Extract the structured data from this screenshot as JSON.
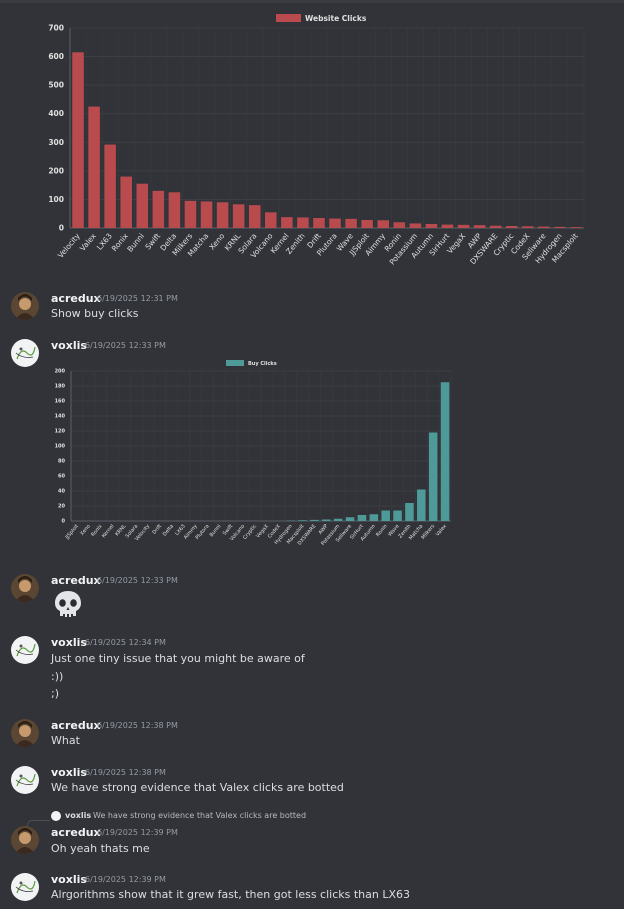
{
  "chart_data": [
    {
      "type": "bar",
      "legend": "Website Clicks",
      "color": "#b94a4d",
      "ylim": [
        0,
        700
      ],
      "yticks": [
        0,
        100,
        200,
        300,
        400,
        500,
        600,
        700
      ],
      "categories": [
        "Velocity",
        "Valex",
        "LX63",
        "Ronix",
        "Bunni",
        "Swift",
        "Delta",
        "Milkers",
        "Matcha",
        "Xeno",
        "KRNL",
        "Solara",
        "Volcano",
        "Kernel",
        "Zenith",
        "Drift",
        "Plutora",
        "Wave",
        "JJSploit",
        "Aimmy",
        "Ronin",
        "Potassium",
        "Autumn",
        "SirHurt",
        "VegaX",
        "AWP",
        "DXSWARE",
        "Cryptic",
        "CodeX",
        "Seliware",
        "Hydrogen",
        "Macsploit"
      ],
      "values": [
        615,
        425,
        292,
        180,
        155,
        130,
        125,
        95,
        93,
        90,
        83,
        80,
        55,
        38,
        37,
        35,
        33,
        32,
        28,
        27,
        20,
        16,
        14,
        12,
        11,
        10,
        8,
        7,
        6,
        5,
        4,
        3
      ]
    },
    {
      "type": "bar",
      "legend": "Buy Clicks",
      "color": "#4d9a98",
      "ylim": [
        0,
        200
      ],
      "yticks": [
        0,
        20,
        40,
        60,
        80,
        100,
        120,
        140,
        160,
        180,
        200
      ],
      "categories": [
        "JJSploit",
        "Xeno",
        "Ronix",
        "Kernel",
        "KRNL",
        "Solara",
        "Velocity",
        "Drift",
        "Delta",
        "LX63",
        "Aimmy",
        "Plutora",
        "Bunni",
        "Swift",
        "Volcano",
        "Cryptic",
        "VegaX",
        "CodeX",
        "Hydrogen",
        "Macsploit",
        "DXSWARE",
        "AWP",
        "Potassium",
        "Seliware",
        "SirHurt",
        "Autumn",
        "Ronin",
        "Wave",
        "Zenith",
        "Matcha",
        "Milkers",
        "Valex"
      ],
      "values": [
        0,
        0,
        0,
        0,
        0,
        0,
        0,
        0,
        0,
        0,
        0,
        0,
        0,
        0,
        0,
        0,
        0,
        0,
        0.5,
        1,
        1.5,
        2,
        3,
        5,
        8,
        9,
        14,
        14,
        24,
        42,
        118,
        185
      ]
    }
  ],
  "colors": {
    "background": "#313338",
    "username": "#f2f3f5",
    "timestamp": "#949ba4"
  },
  "messages": [
    {
      "author": "acredux",
      "time": "6/19/2025 12:31 PM",
      "lines": [
        "Show buy clicks"
      ]
    },
    {
      "author": "voxlis",
      "time": "6/19/2025 12:33 PM",
      "lines": []
    },
    {
      "author": "acredux",
      "time": "6/19/2025 12:33 PM",
      "lines": [],
      "emoji": "skull-emoji"
    },
    {
      "author": "voxlis",
      "time": "6/19/2025 12:34 PM",
      "lines": [
        "Just one tiny issue that you might be aware of",
        ":))",
        ";)"
      ]
    },
    {
      "author": "acredux",
      "time": "6/19/2025 12:38 PM",
      "lines": [
        "What"
      ]
    },
    {
      "author": "voxlis",
      "time": "6/19/2025 12:38 PM",
      "lines": [
        "We have strong evidence that Valex clicks are botted"
      ]
    },
    {
      "author": "acredux",
      "time": "6/19/2025 12:39 PM",
      "lines": [
        "Oh yeah thats me"
      ],
      "reply": {
        "author": "voxlis",
        "text": "We have strong evidence that Valex clicks are botted"
      }
    },
    {
      "author": "voxlis",
      "time": "6/19/2025 12:39 PM",
      "lines": [
        "Alrgorithms show that it grew fast, then got less clicks than LX63"
      ]
    }
  ]
}
